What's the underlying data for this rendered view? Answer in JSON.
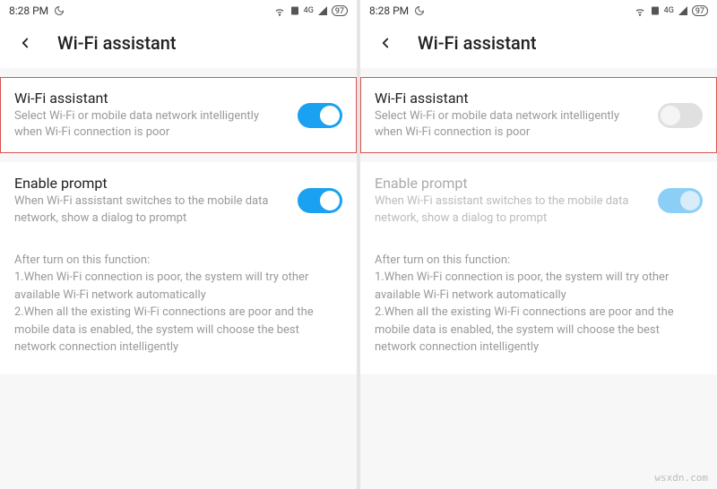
{
  "status": {
    "time": "8:28 PM",
    "signal_label": "4G",
    "battery": "97"
  },
  "header": {
    "title": "Wi-Fi assistant"
  },
  "settings": {
    "wifi_assistant": {
      "title": "Wi-Fi assistant",
      "desc": "Select Wi-Fi or mobile data network intelligently when Wi-Fi connection is poor"
    },
    "enable_prompt": {
      "title": "Enable prompt",
      "desc": "When Wi-Fi assistant switches to the mobile data network, show a dialog to prompt"
    }
  },
  "info": {
    "heading": "After turn on this function:",
    "line1": "1.When Wi-Fi connection is poor, the system will try other available Wi-Fi network automatically",
    "line2": "2.When all the existing Wi-Fi connections are poor and the mobile data is enabled, the system will choose the best network connection intelligently"
  },
  "watermark": "wsxdn.com"
}
